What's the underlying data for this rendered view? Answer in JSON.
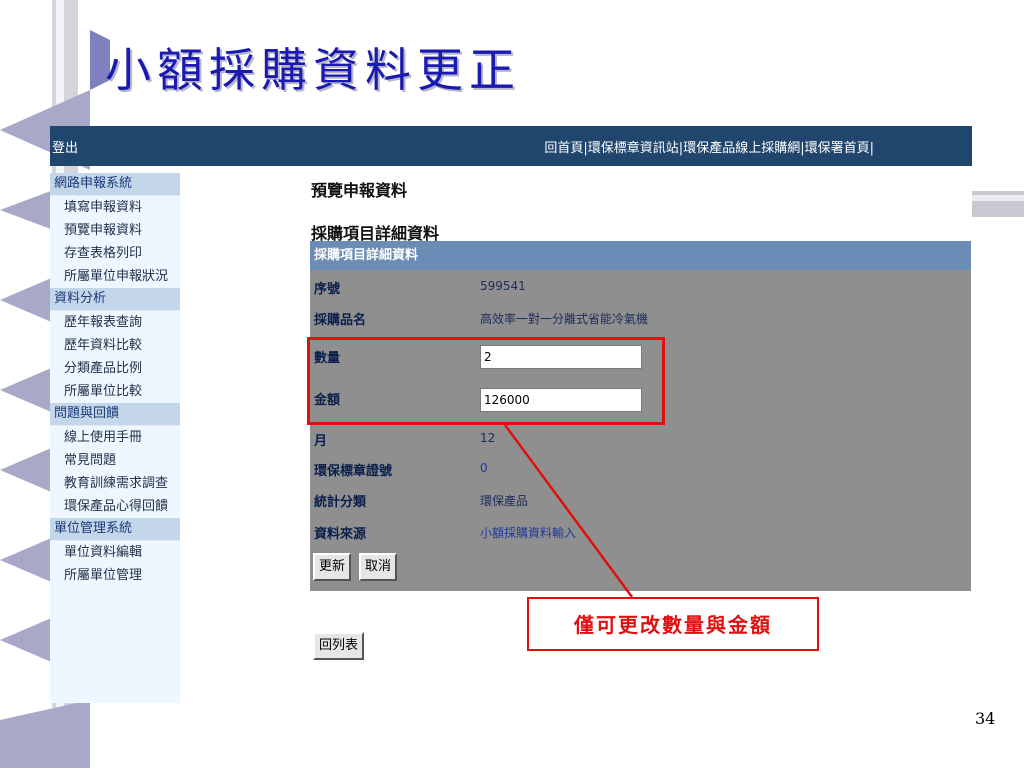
{
  "slide": {
    "title": "小額採購資料更正",
    "page_number": "34",
    "callout_text": "僅可更改數量與金額"
  },
  "topbar": {
    "logout": "登出",
    "links": [
      "回首頁",
      "|",
      "環保標章資訊站",
      "|",
      "環保產品線上採購網",
      "|",
      "環保署首頁",
      "|"
    ]
  },
  "sidebar": {
    "sections": [
      {
        "title": "網路申報系統",
        "items": [
          "填寫申報資料",
          "預覽申報資料",
          "存查表格列印",
          "所屬單位申報狀況"
        ]
      },
      {
        "title": "資料分析",
        "items": [
          "歷年報表查詢",
          "歷年資料比較",
          "分類產品比例",
          "所屬單位比較"
        ]
      },
      {
        "title": "問題與回饋",
        "items": [
          "線上使用手冊",
          "常見問題",
          "教育訓練需求調查",
          "環保產品心得回饋"
        ]
      },
      {
        "title": "單位管理系統",
        "items": [
          "單位資料編輯",
          "所屬單位管理"
        ]
      }
    ]
  },
  "main": {
    "heading": "預覽申報資料",
    "subheading": "採購項目詳細資料",
    "panel_title": "採購項目詳細資料",
    "fields": {
      "serial_label": "序號",
      "serial_value": "599541",
      "item_label": "採購品名",
      "item_value": "高效率一對一分離式省能冷氣機",
      "quantity_label": "數量",
      "quantity_value": "2",
      "amount_label": "金額",
      "amount_value": "126000",
      "month_label": "月",
      "month_value": "12",
      "ecolabel_label": "環保標章證號",
      "ecolabel_value": "0",
      "category_label": "統計分類",
      "category_value": "環保產品",
      "source_label": "資料來源",
      "source_value": "小額採購資料輸入"
    },
    "update_button": "更新",
    "cancel_button": "取消",
    "back_button": "回列表"
  },
  "colors": {
    "title": "#1a1ab0",
    "topbar": "#21466e",
    "panel_header": "#6a8cb6",
    "panel_body": "#8f8f8f",
    "highlight": "#e01010"
  }
}
